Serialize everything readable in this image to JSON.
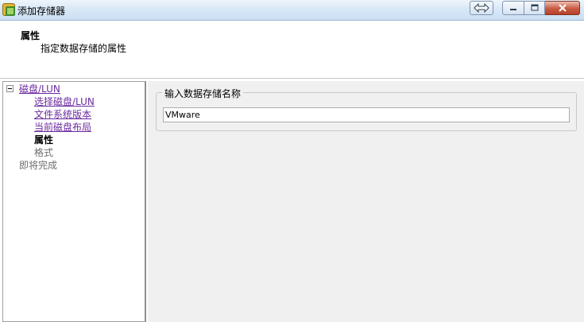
{
  "window": {
    "title": "添加存储器",
    "icon": "vsphere-app-icon",
    "controls": {
      "switch": "switch-view-icon",
      "minimize": "minimize-icon",
      "maximize": "maximize-icon",
      "close": "close-icon"
    }
  },
  "header": {
    "title": "属性",
    "subtitle": "指定数据存储的属性"
  },
  "nav": {
    "root": {
      "label": "磁盘/LUN",
      "state": "link"
    },
    "children": [
      {
        "label": "选择磁盘/LUN",
        "state": "link"
      },
      {
        "label": "文件系统版本",
        "state": "link"
      },
      {
        "label": "当前磁盘布局",
        "state": "link"
      },
      {
        "label": "属性",
        "state": "current"
      },
      {
        "label": "格式",
        "state": "disabled"
      }
    ],
    "finish": {
      "label": "即将完成",
      "state": "disabled"
    }
  },
  "form": {
    "group_label": "输入数据存储名称",
    "datastore_name": "VMware"
  },
  "colors": {
    "link": "#6b2a9f",
    "content_bg": "#f0f0f0",
    "titlebar": "#d9e8f6",
    "close_button": "#c85a43"
  }
}
